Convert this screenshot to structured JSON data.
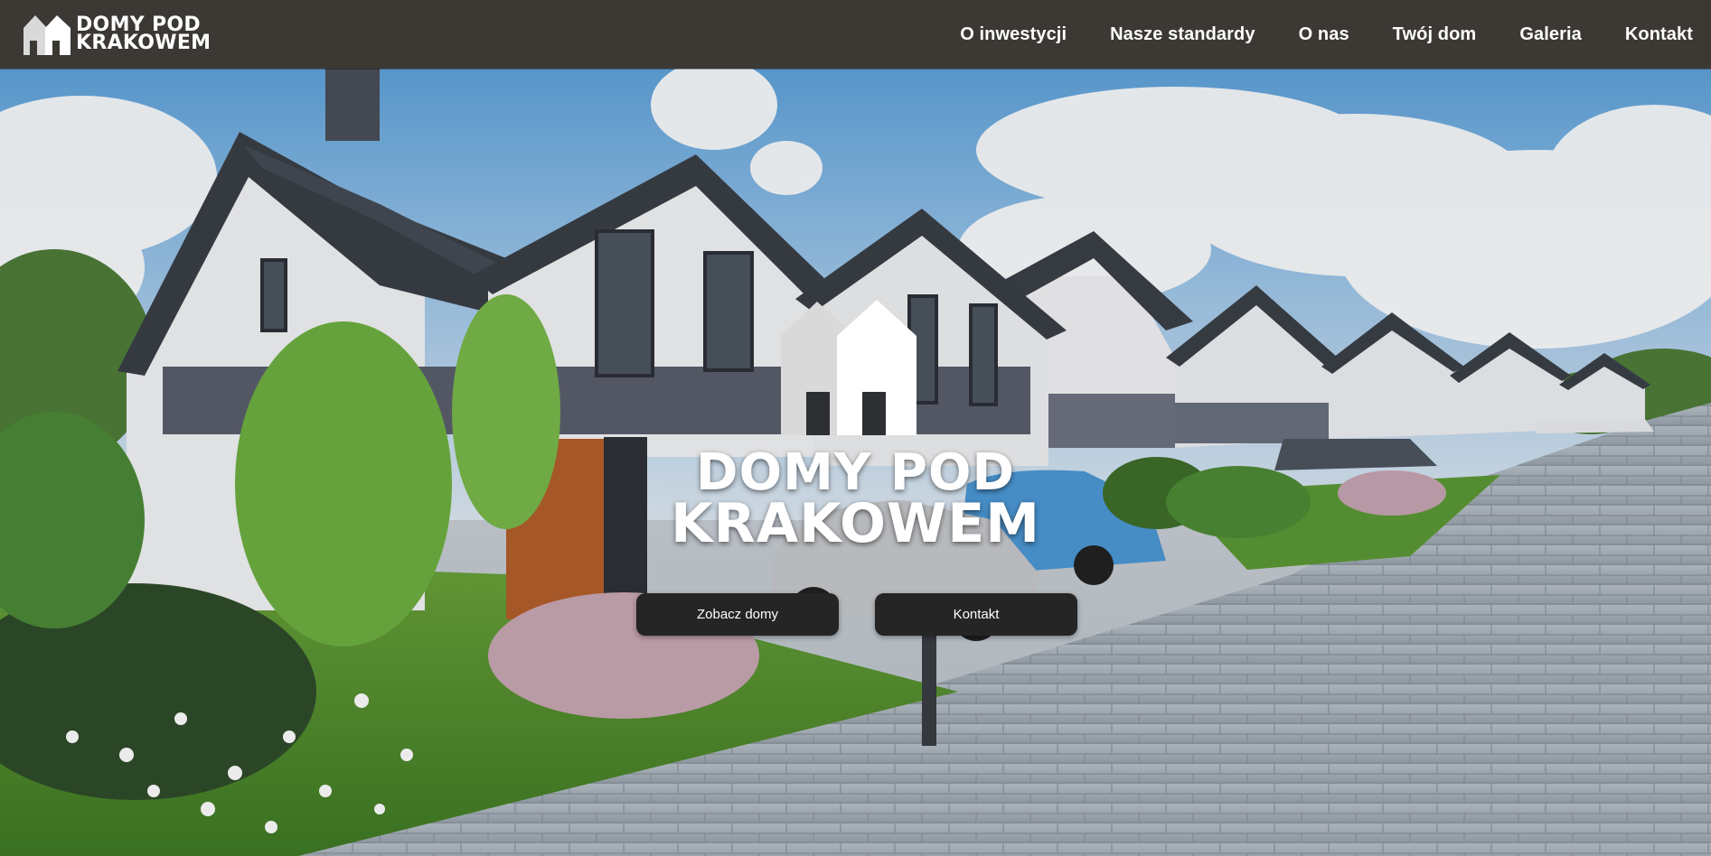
{
  "header": {
    "logo": {
      "line1": "DOMY POD",
      "line2": "KRAKOWEM"
    },
    "nav": [
      {
        "label": "O inwestycji"
      },
      {
        "label": "Nasze standardy"
      },
      {
        "label": "O nas"
      },
      {
        "label": "Twój dom"
      },
      {
        "label": "Galeria"
      },
      {
        "label": "Kontakt"
      }
    ]
  },
  "hero": {
    "title_line1": "DOMY POD",
    "title_line2": "KRAKOWEM",
    "buttons": {
      "primary": "Zobacz domy",
      "secondary": "Kontakt"
    }
  },
  "colors": {
    "header_bg": "#3c3935",
    "button_bg": "#252525",
    "text": "#ffffff"
  }
}
